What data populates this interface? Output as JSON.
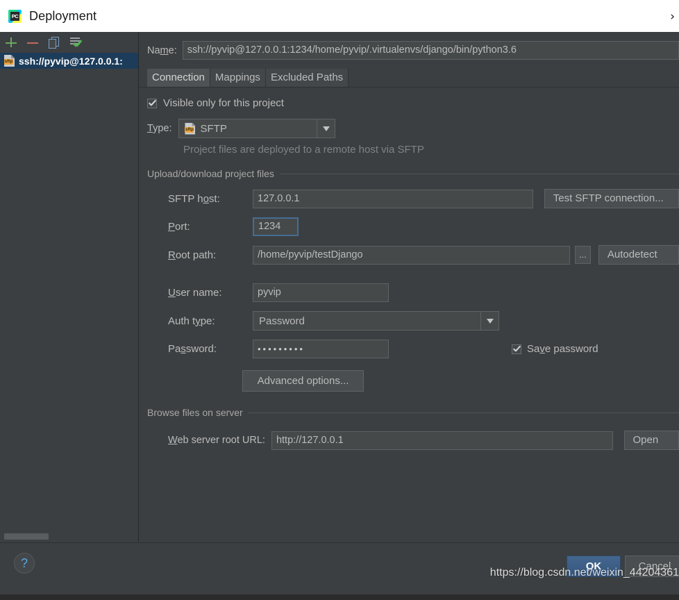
{
  "window": {
    "title": "Deployment",
    "logo_text": "PC",
    "expand_chevron": "›"
  },
  "sidebar": {
    "toolbar": [
      {
        "name": "add",
        "glyph": "+"
      },
      {
        "name": "remove",
        "glyph": "−"
      },
      {
        "name": "copy",
        "glyph": "copy"
      },
      {
        "name": "use-as-default",
        "glyph": "default"
      }
    ],
    "items": [
      {
        "label": "ssh://pyvip@127.0.0.1:",
        "icon": "sftp",
        "icon_text": "sftp",
        "selected": true
      }
    ]
  },
  "name_row": {
    "label_prefix": "Na",
    "label_mnemonic": "m",
    "label_suffix": "e:",
    "value": "ssh://pyvip@127.0.0.1:1234/home/pyvip/.virtualenvs/django/bin/python3.6"
  },
  "tabs": [
    {
      "label": "Connection",
      "active": true
    },
    {
      "label": "Mappings",
      "active": false
    },
    {
      "label": "Excluded Paths",
      "active": false
    }
  ],
  "connection": {
    "visible_only": {
      "label": "Visible only for this project",
      "checked": true
    },
    "type": {
      "label_prefix": "",
      "label_mnemonic": "T",
      "label_suffix": "ype:",
      "value": "SFTP",
      "icon_text": "sftp",
      "hint": "Project files are deployed to a remote host via SFTP"
    },
    "upload_group": {
      "title": "Upload/download project files",
      "rows": [
        {
          "name": "sftp-host",
          "label_pre": "SFTP h",
          "label_mn": "o",
          "label_post": "st:",
          "value": "127.0.0.1",
          "focused": false,
          "button": "Test SFTP connection..."
        },
        {
          "name": "port",
          "label_pre": "",
          "label_mn": "P",
          "label_post": "ort:",
          "value": "1234",
          "focused": true,
          "button": ""
        },
        {
          "name": "root-path",
          "label_pre": "",
          "label_mn": "R",
          "label_post": "oot path:",
          "value": "/home/pyvip/testDjango",
          "focused": false,
          "browse": "...",
          "button": "Autodetect"
        },
        {
          "name": "user-name",
          "label_pre": "",
          "label_mn": "U",
          "label_post": "ser name:",
          "value": "pyvip",
          "focused": false,
          "button": ""
        }
      ],
      "auth_type": {
        "label_pre": "Auth t",
        "label_mn": "y",
        "label_post": "pe:",
        "value": "Password"
      },
      "password": {
        "label_pre": "Pa",
        "label_mn": "s",
        "label_post": "sword:",
        "value": "•••••••••",
        "save_label_pre": "Sa",
        "save_label_mn": "v",
        "save_label_post": "e password",
        "save_checked": true
      },
      "advanced_button": "Advanced options..."
    },
    "browse_group": {
      "title": "Browse files on server",
      "web_root": {
        "label_pre": "",
        "label_mn": "W",
        "label_post": "eb server root URL:",
        "value": "http://127.0.0.1",
        "button": "Open"
      }
    }
  },
  "footer": {
    "help": "?",
    "ok": "OK",
    "cancel": "Cancel",
    "watermark": "https://blog.csdn.net/weixin_44204361"
  }
}
